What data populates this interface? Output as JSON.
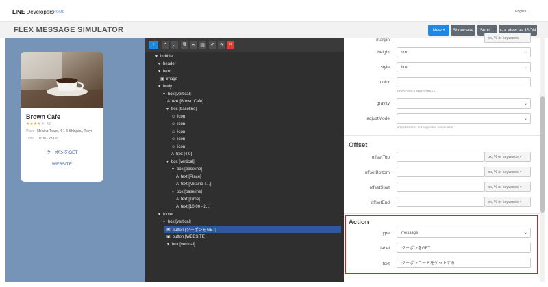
{
  "header": {
    "brand_bold": "LINE",
    "brand_rest": " Developers",
    "home": "HOME",
    "language": "English"
  },
  "toolbar": {
    "title": "FLEX MESSAGE SIMULATOR",
    "new_label": "New",
    "showcase_label": "Showcase",
    "send_label": "Send...",
    "json_label": "</> View as JSON"
  },
  "preview": {
    "title": "Brown Cafe",
    "rating_value": "4.0",
    "rows": [
      {
        "key": "Place",
        "value": "Miraina Tower, 4-1-6 Shinjuku, Tokyo"
      },
      {
        "key": "Time",
        "value": "10:00 - 23:00"
      }
    ],
    "button1": "クーポンをGET",
    "button2": "WEBSITE"
  },
  "tree": {
    "nodes": [
      {
        "label": "bubble"
      },
      {
        "label": "header"
      },
      {
        "label": "hero"
      },
      {
        "label": "image"
      },
      {
        "label": "body"
      },
      {
        "label": "box [vertical]"
      },
      {
        "label": "text [Brown Cafe]"
      },
      {
        "label": "box [baseline]"
      },
      {
        "label": "icon"
      },
      {
        "label": "icon"
      },
      {
        "label": "icon"
      },
      {
        "label": "icon"
      },
      {
        "label": "icon"
      },
      {
        "label": "text [4.0]"
      },
      {
        "label": "box [vertical]"
      },
      {
        "label": "box [baseline]"
      },
      {
        "label": "text [Place]"
      },
      {
        "label": "text [Miraina T...]"
      },
      {
        "label": "box [baseline]"
      },
      {
        "label": "text [Time]"
      },
      {
        "label": "text [10:00 - 2...]"
      },
      {
        "label": "footer"
      },
      {
        "label": "box [vertical]"
      },
      {
        "label": "button [クーポンをGET]"
      },
      {
        "label": "button [WEBSITE]"
      },
      {
        "label": "box [vertical]"
      }
    ]
  },
  "props": {
    "margin_label": "margin",
    "margin_unit": "px, % or keywords",
    "height_label": "height",
    "height_value": "sm",
    "style_label": "style",
    "style_value": "link",
    "color_label": "color",
    "color_value": "",
    "color_hint": "#RRGGBB or #RRGGBBAA",
    "gravity_label": "gravity",
    "gravity_value": "",
    "adjust_label": "adjustMode",
    "adjust_value": "",
    "adjust_hint": "'adjustMode' is not supported in simulator",
    "offset_title": "Offset",
    "offset_rows": [
      {
        "label": "offsetTop",
        "unit": "px, % or keywords"
      },
      {
        "label": "offsetBottom",
        "unit": "px, % or keywords"
      },
      {
        "label": "offsetStart",
        "unit": "px, % or keywords"
      },
      {
        "label": "offsetEnd",
        "unit": "px, % or keywords"
      }
    ],
    "action_title": "Action",
    "type_label": "type",
    "type_value": "message",
    "label_label": "label",
    "label_value": "クーポンをGET",
    "text_label": "text",
    "text_value": "クーポンコードをゲットする"
  }
}
